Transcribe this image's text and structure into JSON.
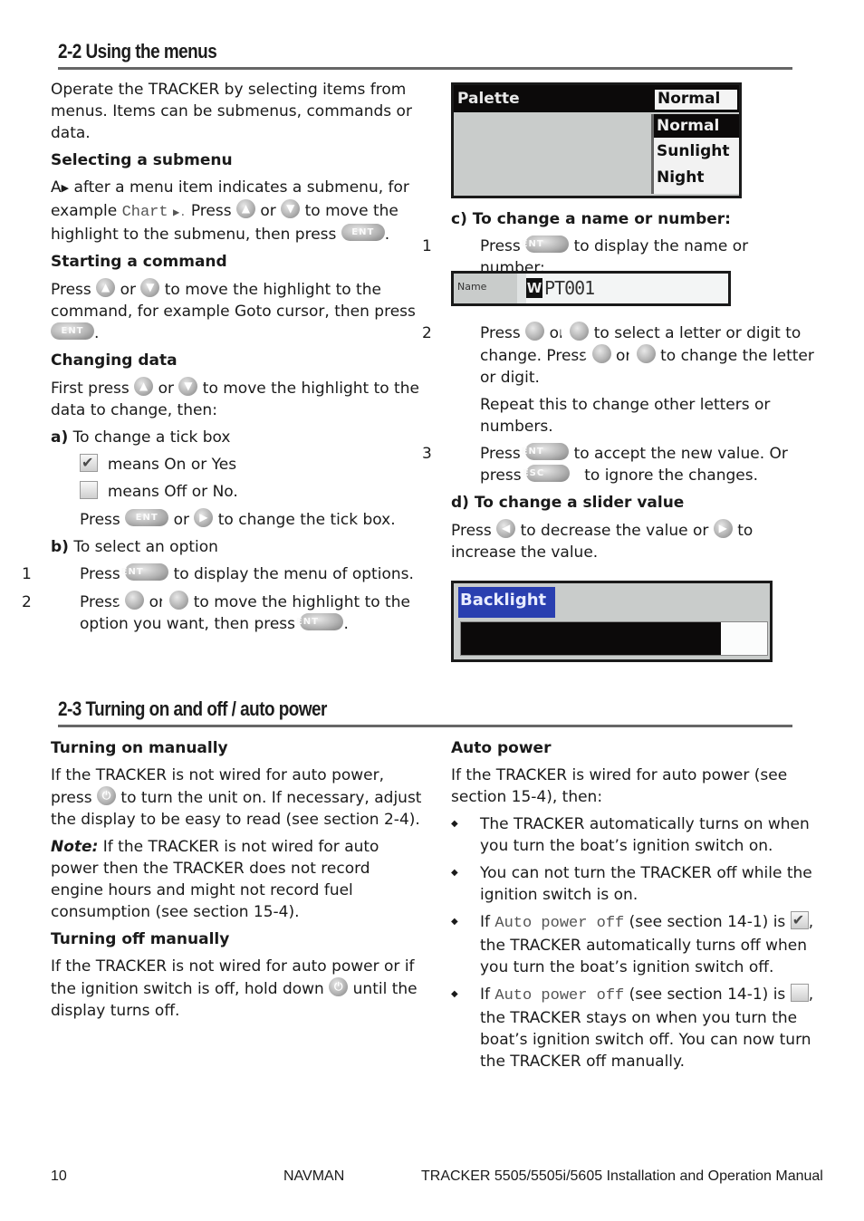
{
  "section_2_2": {
    "heading": "2-2 Using the menus",
    "intro": "Operate the TRACKER by selecting items from menus. Items can be submenus, commands or data.",
    "selecting_submenu": {
      "title": "Selecting a submenu",
      "text_1": "A",
      "text_2": "after a menu item indicates a submenu, for example",
      "example_code": "Chart",
      "text_3": "Press",
      "text_4": "or",
      "text_5": "to move the highlight to the submenu, then press"
    },
    "starting_command": {
      "title": "Starting a command",
      "text_1": "Press",
      "text_2": "or",
      "text_3": "to move the highlight to the command, for example Goto cursor, then press"
    },
    "changing_data": {
      "title": "Changing data",
      "text_1": "First press",
      "text_2": "or",
      "text_3": "to move the highlight to the data to change, then:"
    },
    "tick_box": {
      "label_prefix": "a)",
      "label": "To change a tick box",
      "on_text": "means On or Yes",
      "off_text": "means Off or No.",
      "press_1": "Press",
      "press_2": "or",
      "press_3": "to change the tick box."
    },
    "select_option": {
      "label_prefix": "b)",
      "label": "To select an option",
      "step_1_num": "1",
      "step_1_a": "Press",
      "step_1_b": "to display the menu of options.",
      "step_2_num": "2",
      "step_2_a": "Press",
      "step_2_b": "or",
      "step_2_c": "to move the highlight to the option you want, then press"
    },
    "palette_screen": {
      "title": "Palette",
      "current_value": "Normal",
      "options": [
        "Normal",
        "Sunlight",
        "Night"
      ],
      "highlighted_option": "Normal"
    },
    "change_name": {
      "label": "c) To change a name or number:",
      "step_1_num": "1",
      "step_1_a": "Press",
      "step_1_b": "to display the name or number:",
      "step_2_num": "2",
      "step_2_a": "Press",
      "step_2_b": "or",
      "step_2_c": "to select a letter or digit to change. Press",
      "step_2_d": "or",
      "step_2_e": "to change the letter or digit.",
      "repeat_text": "Repeat this to change other letters or numbers.",
      "step_3_num": "3",
      "step_3_a": "Press",
      "step_3_b": "to accept the new value. Or press",
      "step_3_c": "to ignore the changes."
    },
    "name_screen": {
      "field_label": "Name",
      "cursor_char": "W",
      "value": "PT001"
    },
    "slider": {
      "label": "d) To change a slider value",
      "text_1": "Press",
      "text_2": "to decrease the value or",
      "text_3": "to increase the value."
    },
    "backlight_screen": {
      "title": "Backlight",
      "slider_level_percent": 85,
      "accent_color": "#2a3fb0"
    }
  },
  "section_2_3": {
    "heading": "2-3 Turning on and off / auto power",
    "turning_on": {
      "title": "Turning on manually",
      "text_1": "If the TRACKER is not wired for auto power, press",
      "text_2": "to turn the unit on. If necessary, adjust the display to be easy to read (see section 2-4).",
      "note_label": "Note:",
      "note_text": "If the TRACKER is not wired for auto power then the TRACKER does not record engine hours and might not record fuel consumption (see section 15-4)."
    },
    "turning_off": {
      "title": "Turning off manually",
      "text_1": "If the TRACKER is not wired for auto power or if the ignition switch is off, hold down",
      "text_2": "until the display turns off."
    },
    "auto_power": {
      "title": "Auto power",
      "intro": "If the TRACKER is wired for auto power (see section 15-4), then:",
      "bullet_1": "The TRACKER automatically turns on when you turn the boat’s ignition switch on.",
      "bullet_2": "You can not turn the TRACKER off while the ignition switch is on.",
      "bullet_3_a": "If",
      "bullet_3_code": "Auto power off",
      "bullet_3_b": "(see section 14-1) is",
      "bullet_3_c": ", the TRACKER automatically turns off when you turn the boat’s ignition switch off.",
      "bullet_4_a": "If",
      "bullet_4_code": "Auto power off",
      "bullet_4_b": "(see section 14-1) is",
      "bullet_4_c": ", the TRACKER stays on when you turn the boat’s ignition switch off. You can now turn the TRACKER off manually."
    }
  },
  "icons": {
    "up": "▲",
    "down": "▼",
    "left": "◀",
    "right": "▶",
    "ent": "ENT",
    "esc": "ESC",
    "power": "⏻",
    "submenu_arrow": "▶"
  },
  "footer": {
    "page_number": "10",
    "brand": "NAVMAN",
    "manual_title": "TRACKER 5505/5505i/5605 Installation and Operation Manual"
  }
}
